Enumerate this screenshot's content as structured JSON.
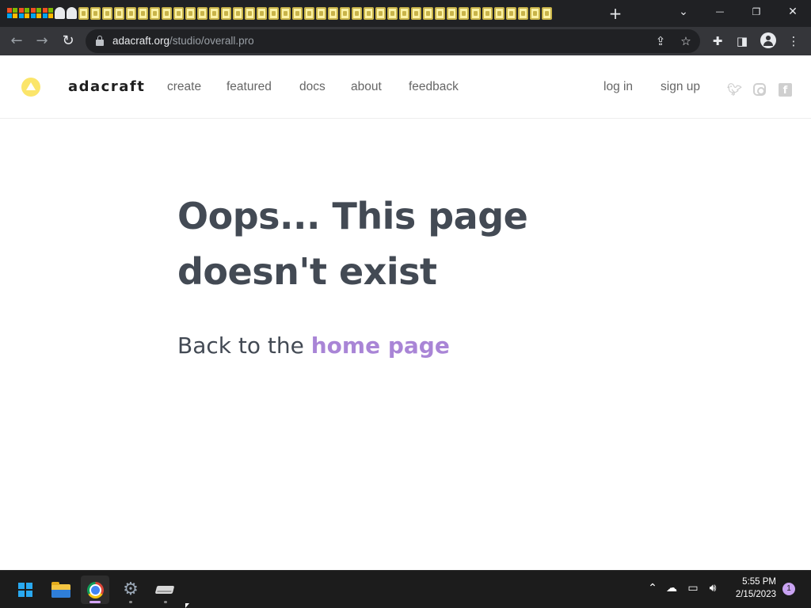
{
  "browser": {
    "tab_favicons": [
      "microsoft-icon",
      "microsoft-icon",
      "microsoft-icon",
      "microsoft-icon",
      "github-icon",
      "github-icon",
      "adacraft-icon"
    ],
    "new_tab": "+",
    "window_controls": {
      "list_tabs": "⌄",
      "minimize": "—",
      "maximize": "❐",
      "close": "✕"
    },
    "url_host": "adacraft.org",
    "url_path": "/studio/overall.pro"
  },
  "site": {
    "brand": "adacraft",
    "nav": [
      {
        "label": "create"
      },
      {
        "label": "featured"
      },
      {
        "label": "docs"
      },
      {
        "label": "about"
      },
      {
        "label": "feedback"
      }
    ],
    "login": "log in",
    "signup": "sign up",
    "social": [
      "twitter-icon",
      "instagram-icon",
      "facebook-icon"
    ],
    "colors": {
      "logo": "#fbe56a",
      "link": "#a985d6",
      "text": "#434a54"
    }
  },
  "main": {
    "title": "Oops... This page doesn't exist",
    "back_prefix": "Back to the ",
    "back_link": "home page"
  },
  "taskbar": {
    "apps": [
      "start-icon",
      "file-explorer-icon",
      "chrome-icon",
      "settings-icon",
      "drive-icon"
    ],
    "time": "5:55 PM",
    "date": "2/15/2023",
    "notifications": "1"
  }
}
